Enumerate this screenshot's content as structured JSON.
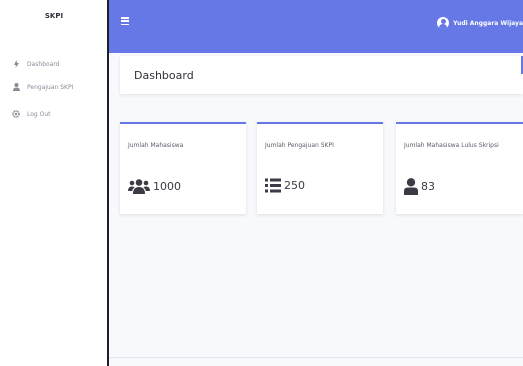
{
  "sidebar": {
    "brand": "SKPI",
    "items": [
      {
        "label": "Dashboard",
        "icon": "dashboard-icon"
      },
      {
        "label": "Pengajuan SKPI",
        "icon": "user-icon"
      },
      {
        "label": "Log Out",
        "icon": "gear-icon"
      }
    ]
  },
  "topbar": {
    "user_name": "Yudi Anggara Wijaya",
    "accent": "#6677e6"
  },
  "page": {
    "title": "Dashboard"
  },
  "stats": [
    {
      "label": "Jumlah Mahasiswa",
      "value": "1000",
      "icon": "users-icon"
    },
    {
      "label": "Jumlah Pengajuan SKPI",
      "value": "250",
      "icon": "list-icon"
    },
    {
      "label": "Jumlah Mahasiswa Lulus Skripsi",
      "value": "83",
      "icon": "user-icon"
    }
  ]
}
